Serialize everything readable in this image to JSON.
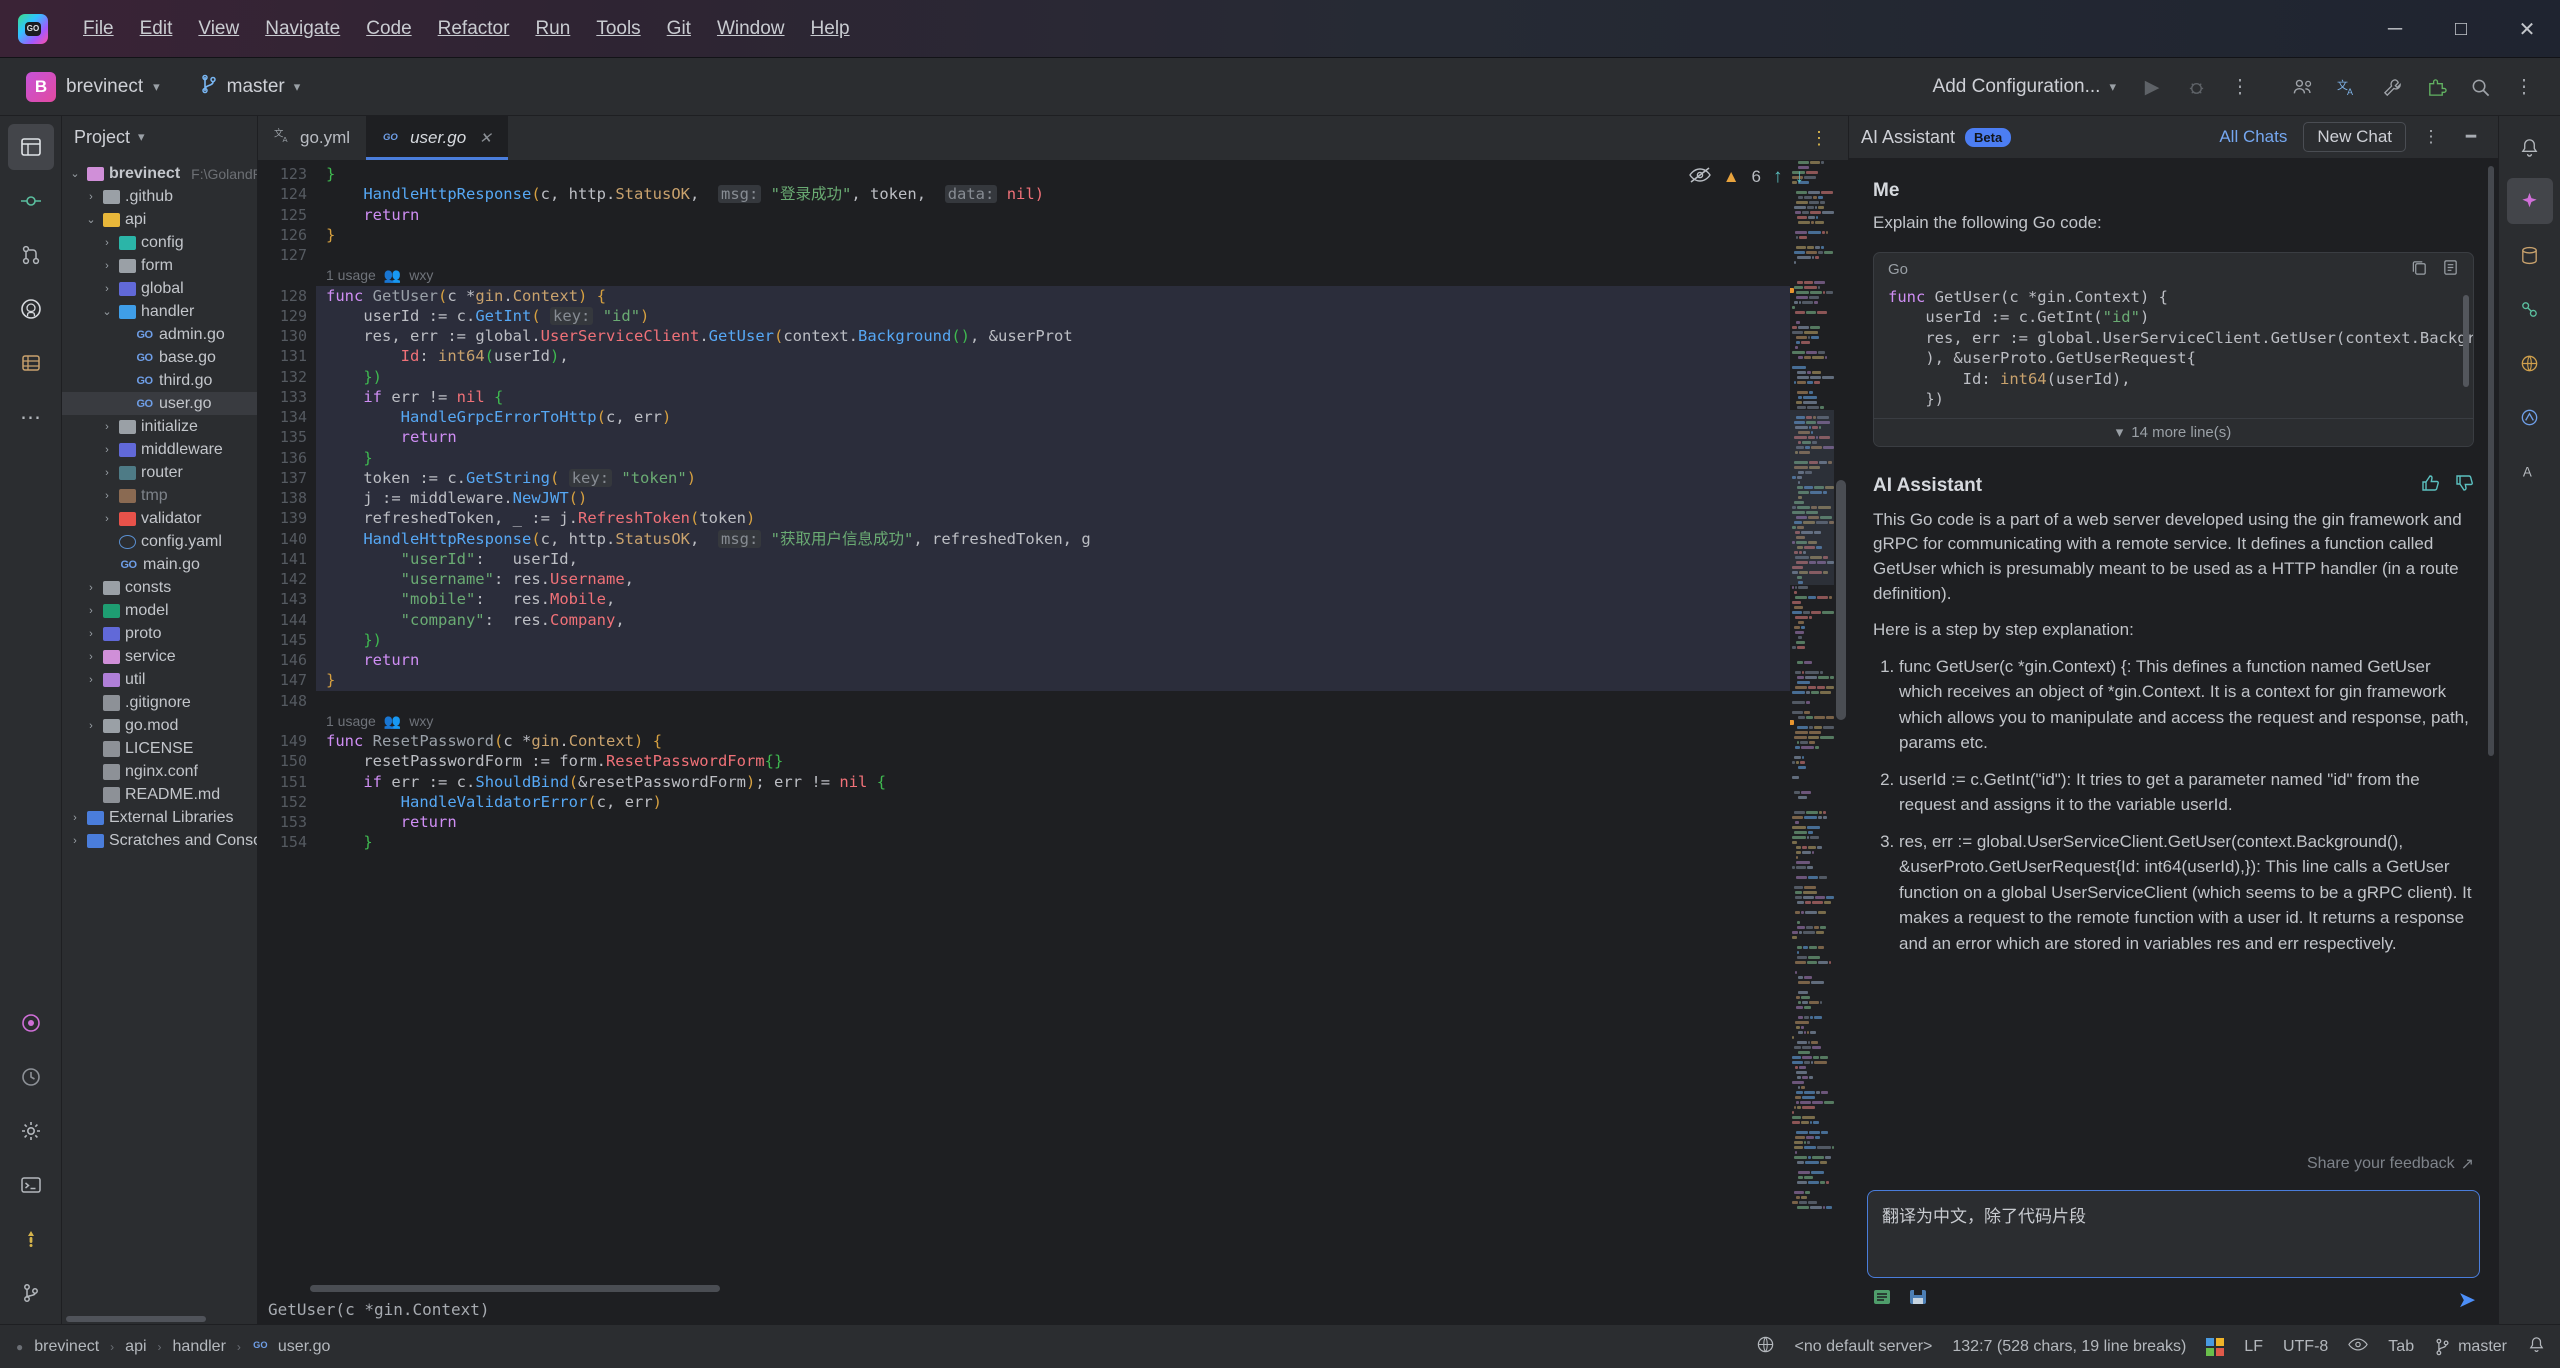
{
  "window": {
    "app_icon": "goland-logo",
    "menus": [
      "File",
      "Edit",
      "View",
      "Navigate",
      "Code",
      "Refactor",
      "Run",
      "Tools",
      "Git",
      "Window",
      "Help"
    ],
    "controls": {
      "minimize": "─",
      "maximize": "□",
      "close": "✕"
    }
  },
  "navbar": {
    "project_badge": "B",
    "project_name": "brevinect",
    "branch_name": "master",
    "run_configuration": "Add Configuration...",
    "icons": [
      "run-icon",
      "debug-icon",
      "more-actions-icon",
      "team-icon",
      "translate-icon",
      "tools-icon",
      "plugin-icon",
      "search-icon",
      "settings-more-icon"
    ]
  },
  "left_rail": {
    "icons": [
      "project-icon",
      "commit-icon",
      "pull-requests-icon",
      "github-icon",
      "database-icon",
      "more-tool-windows-icon",
      "structure-icon",
      "services-icon",
      "settings-icon",
      "terminal-icon",
      "problems-icon",
      "git-branches-icon"
    ]
  },
  "right_rail": {
    "icons": [
      "notifications-icon",
      "ai-assistant-icon",
      "database-icon",
      "gradle-icon",
      "endpoints-icon",
      "makefile-icon",
      "translation-icon"
    ]
  },
  "project_panel": {
    "title": "Project",
    "tree": [
      {
        "indent": 0,
        "arrow": "⌄",
        "icon": "folder-root",
        "label": "brevinect",
        "path": "F:\\GolandPr",
        "bold": true,
        "dim": false,
        "type": "folder",
        "color": "#d08fd8"
      },
      {
        "indent": 1,
        "arrow": "›",
        "icon": "folder-github",
        "label": ".github",
        "type": "folder",
        "color": "#9aa0a6"
      },
      {
        "indent": 1,
        "arrow": "⌄",
        "icon": "folder-module",
        "label": "api",
        "type": "folder",
        "color": "#e8b73a"
      },
      {
        "indent": 2,
        "arrow": "›",
        "icon": "folder-config",
        "label": "config",
        "type": "folder",
        "color": "#2bb5a8"
      },
      {
        "indent": 2,
        "arrow": "›",
        "icon": "folder-plain",
        "label": "form",
        "type": "folder",
        "color": "#9aa0a6"
      },
      {
        "indent": 2,
        "arrow": "›",
        "icon": "folder-global",
        "label": "global",
        "type": "folder",
        "color": "#6169d8"
      },
      {
        "indent": 2,
        "arrow": "⌄",
        "icon": "folder-handler",
        "label": "handler",
        "type": "folder",
        "color": "#3f9ee8"
      },
      {
        "indent": 3,
        "arrow": "",
        "icon": "go-file",
        "label": "admin.go",
        "type": "go"
      },
      {
        "indent": 3,
        "arrow": "",
        "icon": "go-file",
        "label": "base.go",
        "type": "go"
      },
      {
        "indent": 3,
        "arrow": "",
        "icon": "go-file",
        "label": "third.go",
        "type": "go"
      },
      {
        "indent": 3,
        "arrow": "",
        "icon": "go-file",
        "label": "user.go",
        "type": "go",
        "selected": true
      },
      {
        "indent": 2,
        "arrow": "›",
        "icon": "folder-plain",
        "label": "initialize",
        "type": "folder",
        "color": "#9aa0a6"
      },
      {
        "indent": 2,
        "arrow": "›",
        "icon": "folder-middleware",
        "label": "middleware",
        "type": "folder",
        "color": "#6169d8"
      },
      {
        "indent": 2,
        "arrow": "›",
        "icon": "folder-router",
        "label": "router",
        "type": "folder",
        "color": "#4e7b86"
      },
      {
        "indent": 2,
        "arrow": "›",
        "icon": "folder-tmp",
        "label": "tmp",
        "type": "folder",
        "color": "#8a6a52",
        "dim": true
      },
      {
        "indent": 2,
        "arrow": "›",
        "icon": "folder-validator",
        "label": "validator",
        "type": "folder",
        "color": "#e8524a"
      },
      {
        "indent": 2,
        "arrow": "",
        "icon": "yaml-file",
        "label": "config.yaml",
        "type": "yaml"
      },
      {
        "indent": 2,
        "arrow": "",
        "icon": "go-file",
        "label": "main.go",
        "type": "go"
      },
      {
        "indent": 1,
        "arrow": "›",
        "icon": "folder-plain",
        "label": "consts",
        "type": "folder",
        "color": "#9aa0a6"
      },
      {
        "indent": 1,
        "arrow": "›",
        "icon": "folder-model",
        "label": "model",
        "type": "folder",
        "color": "#1e9e72"
      },
      {
        "indent": 1,
        "arrow": "›",
        "icon": "folder-proto",
        "label": "proto",
        "type": "folder",
        "color": "#6169d8"
      },
      {
        "indent": 1,
        "arrow": "›",
        "icon": "folder-service",
        "label": "service",
        "type": "folder",
        "color": "#d08fd8"
      },
      {
        "indent": 1,
        "arrow": "›",
        "icon": "folder-util",
        "label": "util",
        "type": "folder",
        "color": "#b07fd8"
      },
      {
        "indent": 1,
        "arrow": "",
        "icon": "gitignore-file",
        "label": ".gitignore",
        "type": "file"
      },
      {
        "indent": 1,
        "arrow": "›",
        "icon": "folder-plain",
        "label": "go.mod",
        "type": "folder",
        "color": "#9aa0a6"
      },
      {
        "indent": 1,
        "arrow": "",
        "icon": "license-file",
        "label": "LICENSE",
        "type": "file"
      },
      {
        "indent": 1,
        "arrow": "",
        "icon": "conf-file",
        "label": "nginx.conf",
        "type": "file"
      },
      {
        "indent": 1,
        "arrow": "",
        "icon": "md-file",
        "label": "README.md",
        "type": "file"
      },
      {
        "indent": 0,
        "arrow": "›",
        "icon": "libraries-icon",
        "label": "External Libraries",
        "type": "lib"
      },
      {
        "indent": 0,
        "arrow": "›",
        "icon": "scratches-icon",
        "label": "Scratches and Consoles",
        "type": "lib"
      }
    ]
  },
  "editor": {
    "tabs": [
      {
        "label": "go.yml",
        "icon": "translate-file-icon",
        "active": false,
        "closable": false
      },
      {
        "label": "user.go",
        "icon": "go-file-icon",
        "active": true,
        "closable": true
      }
    ],
    "inspection": {
      "warning_icon": "warning-triangle",
      "warning_count": "6",
      "eye_icon": "inspection-eye-off",
      "up": "↑",
      "down": "↓"
    },
    "first_line_number": 123,
    "lines": [
      {
        "n": 123,
        "segs": [
          {
            "t": "}",
            "c": "brc2"
          }
        ],
        "indent": 0
      },
      {
        "n": 124,
        "segs": [
          {
            "t": "HandleHttpResponse",
            "c": "fn"
          },
          {
            "t": "(",
            "c": "brc"
          },
          {
            "t": "c",
            "c": "id"
          },
          {
            "t": ", ",
            "c": "id"
          },
          {
            "t": "http",
            "c": "id"
          },
          {
            "t": ".",
            "c": "id"
          },
          {
            "t": "StatusOK",
            "c": "typ"
          },
          {
            "t": ",  ",
            "c": "id"
          },
          {
            "t": "msg:",
            "c": "hintbox"
          },
          {
            "t": " ",
            "c": "id"
          },
          {
            "t": "\"登录成功\"",
            "c": "str"
          },
          {
            "t": ", token,  ",
            "c": "id"
          },
          {
            "t": "data:",
            "c": "hintbox"
          },
          {
            "t": " nil)",
            "c": "red"
          }
        ],
        "indent": 1
      },
      {
        "n": 125,
        "segs": [
          {
            "t": "return",
            "c": "kw"
          }
        ],
        "indent": 1,
        "indentbar": true
      },
      {
        "n": 126,
        "segs": [
          {
            "t": "}",
            "c": "brc"
          }
        ],
        "indent": 0
      },
      {
        "n": 127,
        "segs": [],
        "indent": 0
      }
    ],
    "usage_label_1": "1 usage",
    "usage_author_1": "wxy",
    "usage_label_2": "1 usage",
    "usage_author_2": "wxy",
    "breadcrumb": "GetUser(c *gin.Context)"
  },
  "code_lines": [
    {
      "n": 128,
      "hl": true,
      "html": "<span class='kw'>func</span> <span class='decl'>GetUser</span><span class='brc'>(</span><span class='id'>c</span> <span class='id'>*</span><span class='typ'>gin</span><span class='id'>.</span><span class='typ'>Context</span><span class='brc'>)</span> <span class='brc'>{</span>"
    },
    {
      "n": 129,
      "hl": true,
      "html": "    <span class='id'>userId</span> := <span class='id'>c</span>.<span class='fn'>GetInt</span><span class='brc'>(</span> <span class='hint-box'>key:</span> <span class='str'>\"id\"</span><span class='brc'>)</span>"
    },
    {
      "n": 130,
      "hl": true,
      "html": "    <span class='id'>res</span>, <span class='id'>err</span> := <span class='id'>global</span>.<span class='err'>UserServiceClient</span>.<span class='fn'>GetUser</span><span class='brc'>(</span><span class='id'>context</span>.<span class='fn'>Background</span><span class='brc2'>()</span>, &amp;<span class='id'>userProt</span>"
    },
    {
      "n": 131,
      "hl": true,
      "html": "        <span class='err'>Id</span>: <span class='typ'>int64</span><span class='brc2'>(</span><span class='id'>userId</span><span class='brc2'>)</span>,"
    },
    {
      "n": 132,
      "hl": true,
      "html": "    <span class='brc2'>})</span>"
    },
    {
      "n": 133,
      "hl": true,
      "html": "    <span class='kw'>if</span> <span class='id'>err</span> != <span class='err'>nil</span> <span class='brc2'>{</span>"
    },
    {
      "n": 134,
      "hl": true,
      "html": "        <span class='fn'>HandleGrpcErrorToHttp</span><span class='brc'>(</span><span class='id'>c</span>, <span class='id'>err</span><span class='brc'>)</span>"
    },
    {
      "n": 135,
      "hl": true,
      "html": "        <span class='kw'>return</span>"
    },
    {
      "n": 136,
      "hl": true,
      "html": "    <span class='brc2'>}</span>"
    },
    {
      "n": 137,
      "hl": true,
      "html": "    <span class='id'>token</span> := <span class='id'>c</span>.<span class='fn'>GetString</span><span class='brc'>(</span> <span class='hint-box'>key:</span> <span class='str'>\"token\"</span><span class='brc'>)</span>"
    },
    {
      "n": 138,
      "hl": true,
      "html": "    <span class='id'>j</span> := <span class='id'>middleware</span>.<span class='fn'>NewJWT</span><span class='brc'>()</span>"
    },
    {
      "n": 139,
      "hl": true,
      "html": "    <span class='id'>refreshedToken</span>, _ := <span class='id'>j</span>.<span class='err'>RefreshToken</span><span class='brc'>(</span><span class='id'>token</span><span class='brc'>)</span>"
    },
    {
      "n": 140,
      "hl": true,
      "html": "    <span class='fn'>HandleHttpResponse</span><span class='brc'>(</span><span class='id'>c</span>, <span class='id'>http</span>.<span class='typ'>StatusOK</span>,  <span class='hint-box'>msg:</span> <span class='str'>\"获取用户信息成功\"</span>, <span class='id'>refreshedToken</span>, <span class='id'>g</span>"
    },
    {
      "n": 141,
      "hl": true,
      "html": "        <span class='str'>\"userId\"</span>:   <span class='id'>userId</span>,"
    },
    {
      "n": 142,
      "hl": true,
      "html": "        <span class='str'>\"username\"</span>: <span class='id'>res</span>.<span class='err'>Username</span>,"
    },
    {
      "n": 143,
      "hl": true,
      "html": "        <span class='str'>\"mobile\"</span>:   <span class='id'>res</span>.<span class='err'>Mobile</span>,"
    },
    {
      "n": 144,
      "hl": true,
      "html": "        <span class='str'>\"company\"</span>:  <span class='id'>res</span>.<span class='err'>Company</span>,"
    },
    {
      "n": 145,
      "hl": true,
      "html": "    <span class='brc2'>})</span>"
    },
    {
      "n": 146,
      "hl": true,
      "html": "    <span class='kw'>return</span>"
    },
    {
      "n": 147,
      "hl": true,
      "html": "<span class='brc'>}</span>"
    },
    {
      "n": 148,
      "hl": false,
      "html": ""
    }
  ],
  "code_lines_2": [
    {
      "n": 149,
      "html": "<span class='kw'>func</span> <span class='decl'>ResetPassword</span><span class='brc'>(</span><span class='id'>c</span> <span class='id'>*</span><span class='typ'>gin</span><span class='id'>.</span><span class='typ'>Context</span><span class='brc'>)</span> <span class='brc'>{</span>"
    },
    {
      "n": 150,
      "html": "    <span class='id'>resetPasswordForm</span> := <span class='id'>form</span>.<span class='err'>ResetPasswordForm</span><span class='brc2'>{}</span>"
    },
    {
      "n": 151,
      "html": "    <span class='kw'>if</span> <span class='id'>err</span> := <span class='id'>c</span>.<span class='fn'>ShouldBind</span><span class='brc'>(</span>&amp;<span class='id'>resetPasswordForm</span><span class='brc'>)</span>; <span class='id'>err</span> != <span class='err'>nil</span> <span class='brc2'>{</span>"
    },
    {
      "n": 152,
      "html": "        <span class='fn'>HandleValidatorError</span><span class='brc'>(</span><span class='id'>c</span>, <span class='id'>err</span><span class='brc'>)</span>"
    },
    {
      "n": 153,
      "html": "        <span class='kw'>return</span>"
    },
    {
      "n": 154,
      "html": "    <span class='brc2'>}</span>"
    }
  ],
  "ai_assistant": {
    "title": "AI Assistant",
    "badge": "Beta",
    "all_chats": "All Chats",
    "new_chat": "New Chat",
    "header_icons": [
      "more-options-icon",
      "minimize-panel-icon"
    ],
    "user_name": "Me",
    "user_prompt": "Explain the following Go code:",
    "code_lang": "Go",
    "code_actions": [
      "copy-icon",
      "insert-icon"
    ],
    "code_snippet": "func GetUser(c *gin.Context) {\n    userId := c.GetInt(\"id\")\n    res, err := global.UserServiceClient.GetUser(context.Background(\n    ), &userProto.GetUserRequest{\n        Id: int64(userId),\n    })",
    "more_lines": "14 more line(s)",
    "assistant_name": "AI Assistant",
    "assistant_icons": [
      "thumbs-up-icon",
      "thumbs-down-icon"
    ],
    "assistant_intro_1": "This Go code is a part of a web server developed using the gin framework and gRPC for communicating with a remote service. It defines a function called GetUser which is presumably meant to be used as a HTTP handler (in a route definition).",
    "assistant_intro_2": "Here is a step by step explanation:",
    "steps": [
      "func GetUser(c *gin.Context) {: This defines a function named GetUser which receives an object of *gin.Context. It is a context for gin framework which allows you to manipulate and access the request and response, path, params etc.",
      "userId := c.GetInt(\"id\"): It tries to get a parameter named \"id\" from the request and assigns it to the variable userId.",
      "res, err := global.UserServiceClient.GetUser(context.Background(), &userProto.GetUserRequest{Id: int64(userId),}): This line calls a GetUser function on a global UserServiceClient (which seems to be a gRPC client). It makes a request to the remote function with a user id. It returns a response and an error which are stored in variables res and err respectively."
    ],
    "feedback": "Share your feedback",
    "feedback_icon": "external-link-icon",
    "input_value": "翻译为中文，除了代码片段",
    "input_icons": [
      "attach-context-icon",
      "save-prompt-icon"
    ],
    "send_icon": "send-icon"
  },
  "status_bar": {
    "breadcrumbs": [
      "brevinect",
      "api",
      "handler",
      "user.go"
    ],
    "breadcrumb_icon": "go-file-icon",
    "server": "<no default server>",
    "server_icon": "globe-icon",
    "caret": "132:7 (528 chars, 19 line breaks)",
    "line_separator": "LF",
    "encoding": "UTF-8",
    "indent": "Tab",
    "branch": "master",
    "eye_icon": "reader-mode-icon",
    "os_icon": "windows-icon",
    "notification_icon": "notification-icon"
  },
  "colors": {
    "accent": "#4a7ddb",
    "panel_bg": "#2b2d30",
    "editor_bg": "#1e1f22",
    "badge": "#4c7ef3",
    "link": "#75a7f0"
  }
}
